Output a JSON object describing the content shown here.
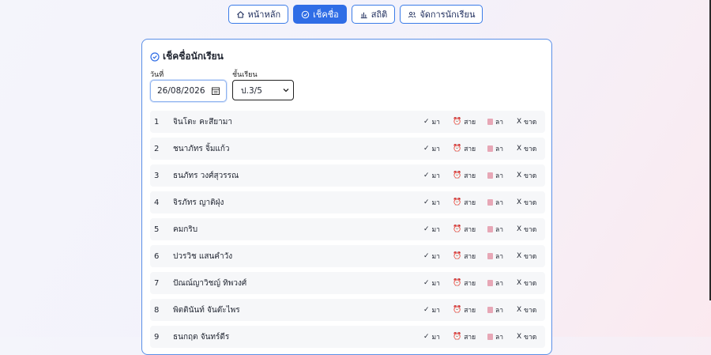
{
  "nav": [
    {
      "label": "หน้าหลัก",
      "icon": "home-icon"
    },
    {
      "label": "เช็คชื่อ",
      "icon": "check-circle-icon",
      "active": true
    },
    {
      "label": "สถิติ",
      "icon": "bar-chart-icon"
    },
    {
      "label": "จัดการนักเรียน",
      "icon": "users-icon"
    }
  ],
  "card": {
    "title": "เช็คชื่อนักเรียน",
    "date_label": "วันที่",
    "date_value": "26/08/2026",
    "class_label": "ชั้นเรียน",
    "class_value": "ป.3/5"
  },
  "options": {
    "present": "มา",
    "late": "สาย",
    "leave": "ลา",
    "absent": "ขาด",
    "present_mark": "✓",
    "absent_mark": "X"
  },
  "students": [
    {
      "no": "1",
      "name": "จินโตะ คะสึยามา"
    },
    {
      "no": "2",
      "name": "ชนาภัทร จิ้มแก้ว"
    },
    {
      "no": "3",
      "name": "ธนภัทร วงศ์สุวรรณ"
    },
    {
      "no": "4",
      "name": "จิรภัทร ญาติฝุ่ง"
    },
    {
      "no": "5",
      "name": "คมกริบ"
    },
    {
      "no": "6",
      "name": "ปวรวิช แสนคำวัง"
    },
    {
      "no": "7",
      "name": "ปัณณ์ญาวิชญ์ ทิพวงศ์"
    },
    {
      "no": "8",
      "name": "พิตตินันท์ จันต๊ะไพร"
    },
    {
      "no": "9",
      "name": "ธนกฤต จันทร์ดีร"
    }
  ],
  "colors": {
    "accent": "#2f6de6",
    "border": "#5b8fe6",
    "late": "#e14b6b",
    "leave": "#e7a7b6"
  }
}
